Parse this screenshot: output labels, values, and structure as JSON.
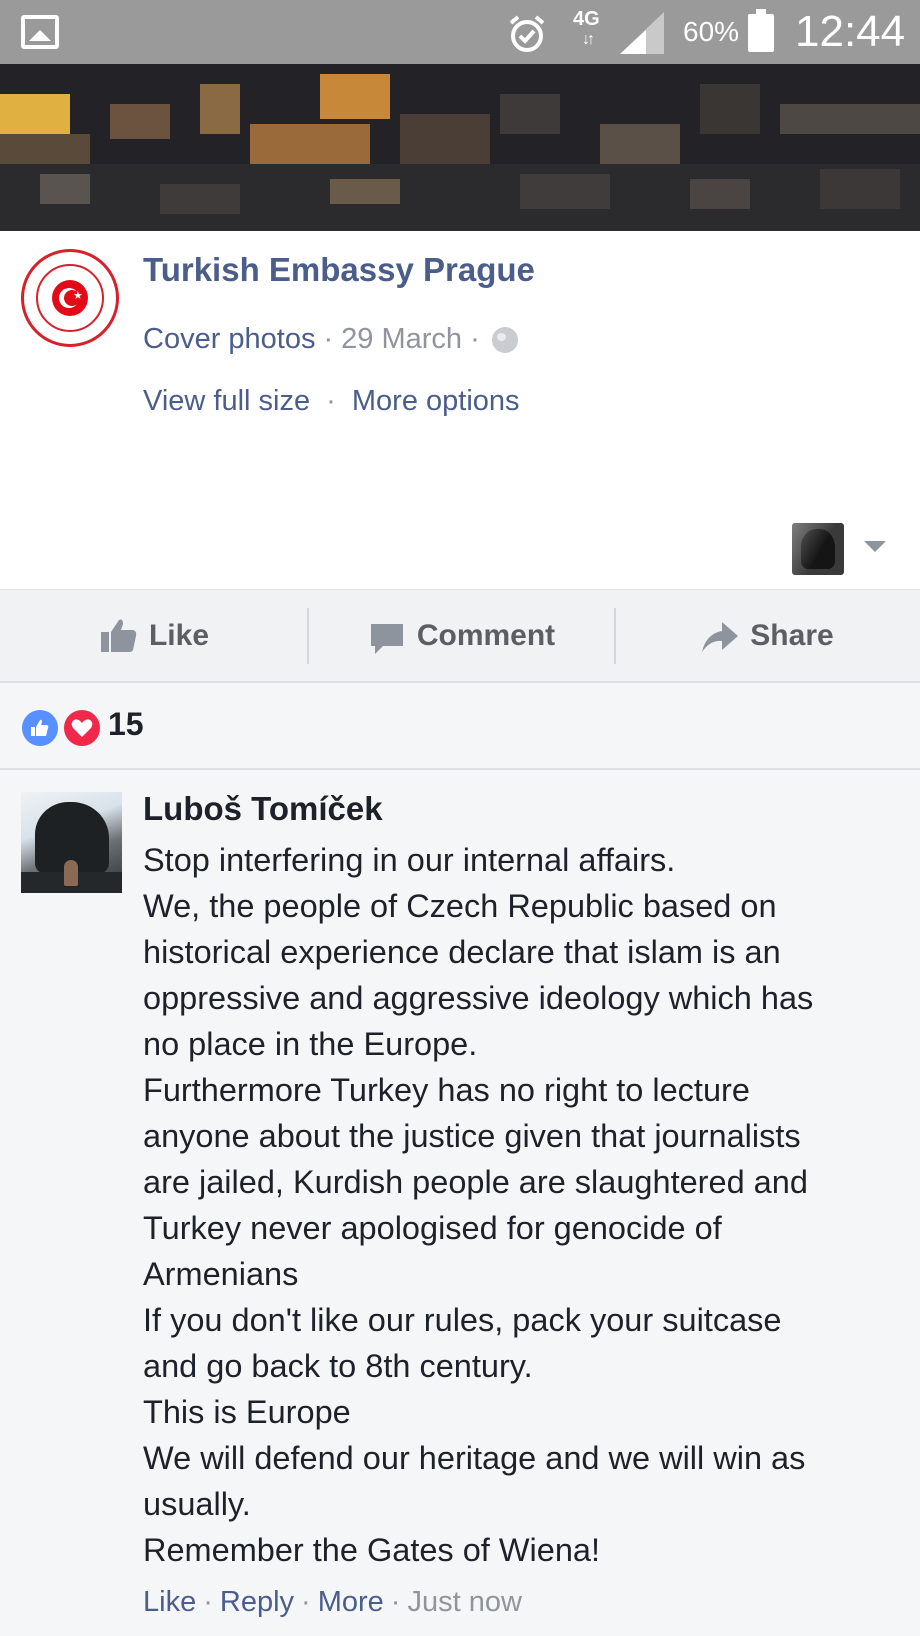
{
  "status_bar": {
    "network": "4G",
    "network_arrows": "↓↑",
    "battery": "60%",
    "time": "12:44"
  },
  "post": {
    "page_name": "Turkish Embassy Prague",
    "album_link": "Cover photos",
    "date": "29 March",
    "meta_separator": "·",
    "privacy_icon": "globe-icon",
    "view_full_size": "View full size",
    "more_options": "More options"
  },
  "actions": {
    "like": "Like",
    "comment": "Comment",
    "share": "Share"
  },
  "reactions": {
    "types": [
      "like",
      "love"
    ],
    "count": "15",
    "colors": {
      "like": "#5890ff",
      "love": "#f0284a"
    }
  },
  "comment": {
    "author": "Luboš Tomíček",
    "lines": [
      "Stop interfering in our internal affairs.",
      "We, the people of Czech Republic based on",
      "historical experience declare that islam is an",
      "oppressive and aggressive ideology which has",
      "no place in the Europe.",
      "Furthermore Turkey has no right to lecture",
      "anyone about the justice given that journalists",
      "are jailed, Kurdish people are slaughtered and",
      "Turkey never apologised for genocide of",
      "Armenians",
      "If you don't like our rules, pack your suitcase",
      "and go back to 8th century.",
      "This is Europe",
      "We will defend our heritage and we will win as",
      "usually.",
      "Remember the Gates of Wiena!"
    ],
    "footer": {
      "like": "Like",
      "reply": "Reply",
      "more": "More",
      "time": "Just now"
    }
  },
  "colors": {
    "link": "#4b5d8a",
    "muted": "#90949c",
    "text": "#1d2129",
    "status_bar": "#9a9a9a"
  }
}
